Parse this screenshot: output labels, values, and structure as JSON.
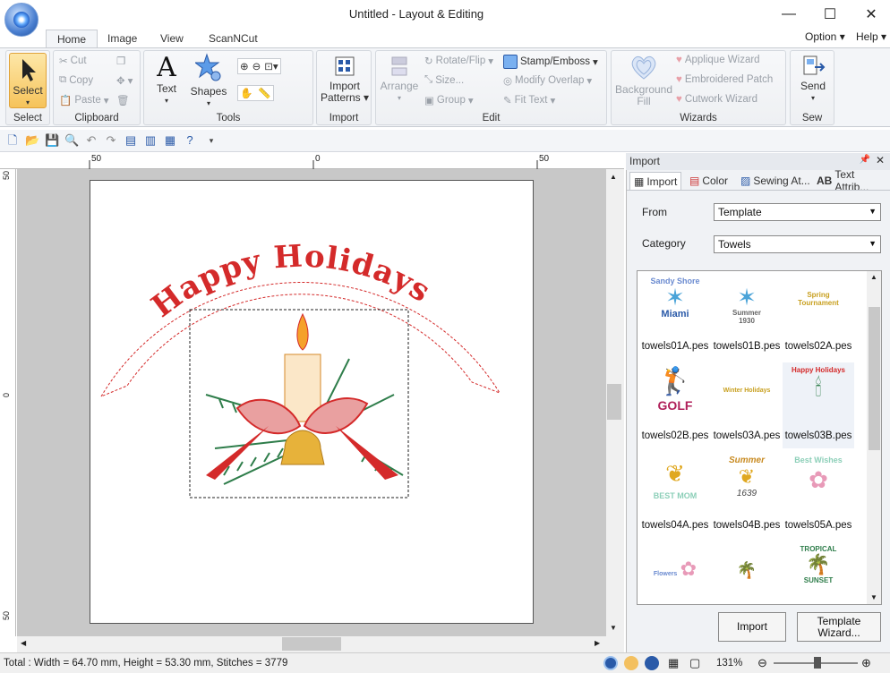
{
  "window": {
    "title": "Untitled - Layout & Editing"
  },
  "tabs": [
    {
      "label": "Home",
      "active": true
    },
    {
      "label": "Image"
    },
    {
      "label": "View"
    },
    {
      "label": "ScanNCut"
    }
  ],
  "help_menu": {
    "option": "Option",
    "help": "Help"
  },
  "ribbon": {
    "select_group": {
      "label": "Select",
      "select_button": "Select"
    },
    "clipboard": {
      "label": "Clipboard",
      "cut": "Cut",
      "copy": "Copy",
      "paste": "Paste"
    },
    "tools": {
      "label": "Tools",
      "text": "Text",
      "shapes": "Shapes"
    },
    "import": {
      "label": "Import",
      "import_patterns_line1": "Import",
      "import_patterns_line2": "Patterns"
    },
    "edit": {
      "label": "Edit",
      "arrange": "Arrange",
      "rotate_flip": "Rotate/Flip",
      "size": "Size...",
      "group": "Group",
      "stamp_emboss": "Stamp/Emboss",
      "modify_overlap": "Modify Overlap",
      "fit_text": "Fit Text"
    },
    "wizards": {
      "label": "Wizards",
      "background_fill_line1": "Background",
      "background_fill_line2": "Fill",
      "applique_wizard": "Applique Wizard",
      "embroidered_patch": "Embroidered Patch",
      "cutwork_wizard": "Cutwork Wizard"
    },
    "sew": {
      "label": "Sew",
      "send": "Send"
    }
  },
  "rulers": {
    "top": [
      "50",
      "0",
      "50"
    ],
    "left": [
      "50",
      "0",
      "50"
    ]
  },
  "design": {
    "arc_text": "Happy Holidays"
  },
  "panel": {
    "title": "Import",
    "tabs": [
      "Import",
      "Color",
      "Sewing At...",
      "Text Attrib..."
    ],
    "from_label": "From",
    "from_value": "Template",
    "category_label": "Category",
    "category_value": "Towels",
    "thumb_texts": {
      "t01a_top": "Sandy Shore",
      "t01a_bottom": "Miami",
      "t01b_line1": "Summer",
      "t01b_line2": "1930",
      "t02a_line1": "Spring",
      "t02a_line2": "Tournament",
      "t02b": "GOLF",
      "t03a": "Winter Holidays",
      "t03b": "Happy Holidays",
      "t04a": "BEST MOM",
      "t04b_top": "Summer",
      "t04b_bottom": "1639",
      "t05a": "Best Wishes",
      "t05b": "Flowers",
      "t06b_top": "TROPICAL",
      "t06b_bottom": "SUNSET"
    },
    "files": [
      "towels01A.pes",
      "towels01B.pes",
      "towels02A.pes",
      "towels02B.pes",
      "towels03A.pes",
      "towels03B.pes",
      "towels04A.pes",
      "towels04B.pes",
      "towels05A.pes"
    ],
    "import_button": "Import",
    "template_wizard_line1": "Template",
    "template_wizard_line2": "Wizard..."
  },
  "status": {
    "text": "Total : Width = 64.70 mm, Height = 53.30 mm, Stitches = 3779",
    "zoom": "131%"
  },
  "colors": {
    "accent_blue": "#2a5aa8",
    "select_orange": "#f6c35a",
    "embroidery_red": "#d42a2a",
    "embroidery_green": "#2e7d4a",
    "work_gray": "#c8c8c8"
  }
}
